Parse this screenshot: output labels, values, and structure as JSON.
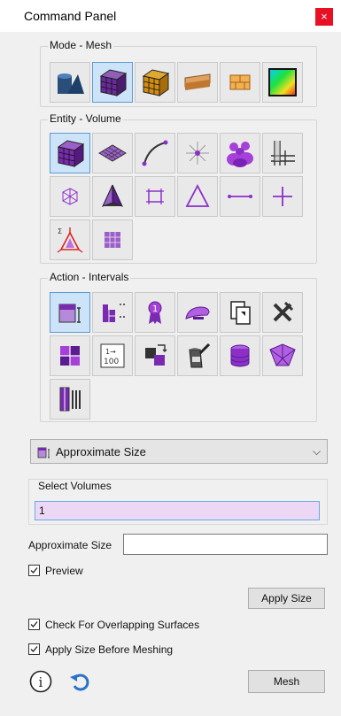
{
  "window": {
    "title": "Command Panel",
    "close_glyph": "×"
  },
  "groups": {
    "mode": "Mode - Mesh",
    "entity": "Entity - Volume",
    "action": "Action - Intervals"
  },
  "mode_buttons": [
    "geometry-icon",
    "mesh-volume-icon",
    "mesh-gold-icon",
    "pipe-icon",
    "brick-icon",
    "color-gradient-icon"
  ],
  "entity_buttons": [
    "volume-icon",
    "surface-icon",
    "curve-icon",
    "vertex-icon",
    "group-icon",
    "grid-icon",
    "node-icon",
    "tet-icon",
    "quad-icon",
    "tri-icon",
    "edge-icon",
    "point-icon",
    "sideset-icon",
    "nodeset-icon"
  ],
  "action_buttons": [
    "approximate-size-icon",
    "interval-icon",
    "ribbon-icon",
    "smooth-icon",
    "copy-icon",
    "remove-icon",
    "match-icon",
    "interval-count-icon",
    "swap-icon",
    "paint-icon",
    "database-icon",
    "sculpt-icon",
    "columns-icon"
  ],
  "dropdown": {
    "selected": "Approximate Size",
    "chevron": "⌵"
  },
  "select_volumes": {
    "label": "Select Volumes",
    "value": "1"
  },
  "approximate_size": {
    "label": "Approximate Size",
    "value": ""
  },
  "preview": {
    "label": "Preview",
    "checked": true
  },
  "apply_size_button": "Apply Size",
  "check_overlap": {
    "label": "Check For Overlapping Surfaces",
    "checked": true
  },
  "apply_before_meshing": {
    "label": "Apply Size Before Meshing",
    "checked": true
  },
  "mesh_button": "Mesh",
  "info_icon_glyph": "i",
  "colors": {
    "accent": "#5b9bd5",
    "selection": "#ecd7f5",
    "close": "#e81123",
    "purple": "#8b2fc9"
  }
}
